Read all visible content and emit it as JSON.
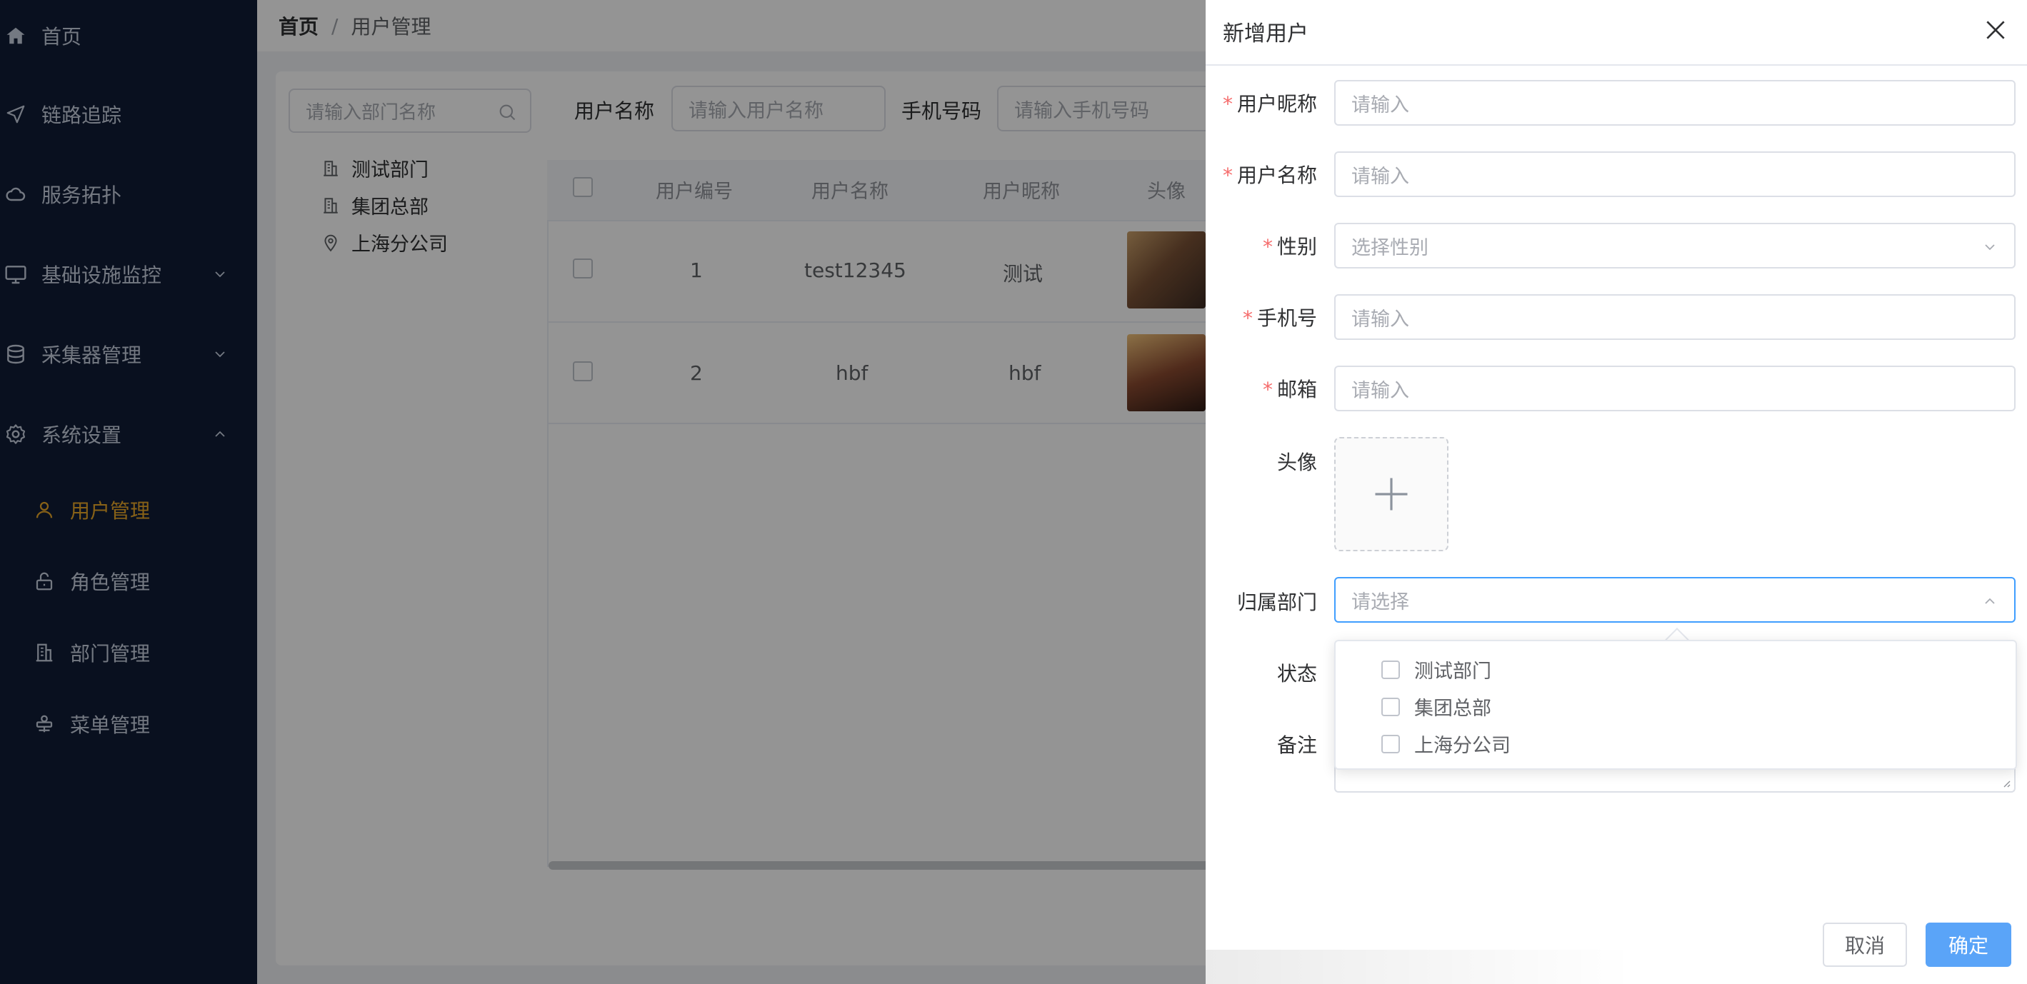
{
  "sidebar": {
    "items": [
      {
        "label": "首页",
        "icon": "home-icon"
      },
      {
        "label": "链路追踪",
        "icon": "send-icon"
      },
      {
        "label": "服务拓扑",
        "icon": "cloud-icon"
      },
      {
        "label": "基础设施监控",
        "icon": "monitor-icon",
        "expand": "chevron-down-icon"
      },
      {
        "label": "采集器管理",
        "icon": "database-icon",
        "expand": "chevron-down-icon"
      },
      {
        "label": "系统设置",
        "icon": "gear-icon",
        "expand": "chevron-up-icon"
      }
    ],
    "sub_items": [
      {
        "label": "用户管理",
        "icon": "user-icon",
        "active": true
      },
      {
        "label": "角色管理",
        "icon": "unlock-icon"
      },
      {
        "label": "部门管理",
        "icon": "office-building-icon"
      },
      {
        "label": "菜单管理",
        "icon": "menu-icon"
      }
    ],
    "active_color": "#e9a829",
    "bg_color": "#101c36"
  },
  "breadcrumb": {
    "home": "首页",
    "separator": "/",
    "current": "用户管理"
  },
  "dept_tree": {
    "search_placeholder": "请输入部门名称",
    "nodes": [
      {
        "label": "测试部门",
        "icon": "building-icon"
      },
      {
        "label": "集团总部",
        "icon": "building-icon"
      },
      {
        "label": "上海分公司",
        "icon": "location-icon"
      }
    ]
  },
  "filters": {
    "username_label": "用户名称",
    "username_placeholder": "请输入用户名称",
    "phone_label": "手机号码",
    "phone_placeholder": "请输入手机号码"
  },
  "table": {
    "columns": [
      "用户编号",
      "用户名称",
      "用户昵称",
      "头像"
    ],
    "rows": [
      {
        "id": "1",
        "username": "test12345",
        "nickname": "测试"
      },
      {
        "id": "2",
        "username": "hbf",
        "nickname": "hbf"
      }
    ]
  },
  "drawer": {
    "title": "新增用户",
    "required_mark": "*",
    "fields": {
      "nickname": {
        "label": "用户昵称",
        "placeholder": "请输入"
      },
      "username": {
        "label": "用户名称",
        "placeholder": "请输入"
      },
      "gender": {
        "label": "性别",
        "placeholder": "选择性别"
      },
      "phone": {
        "label": "手机号",
        "placeholder": "请输入"
      },
      "email": {
        "label": "邮箱",
        "placeholder": "请输入"
      },
      "avatar": {
        "label": "头像"
      },
      "dept": {
        "label": "归属部门",
        "placeholder": "请选择"
      },
      "status": {
        "label": "状态"
      },
      "remark": {
        "label": "备注"
      }
    },
    "dept_options": [
      "测试部门",
      "集团总部",
      "上海分公司"
    ],
    "cancel_label": "取消",
    "confirm_label": "确定",
    "accent_color": "#409eff"
  }
}
